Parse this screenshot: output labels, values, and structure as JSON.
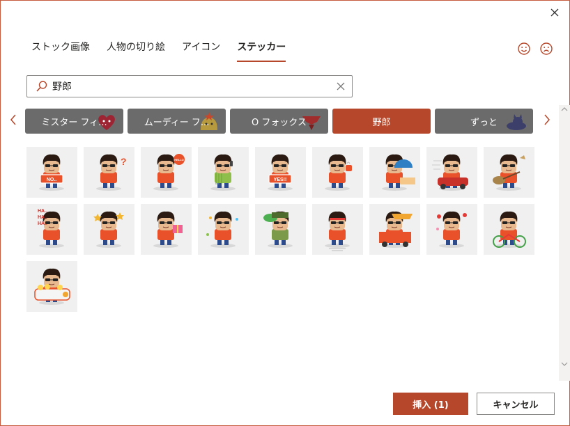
{
  "tabs": [
    {
      "label": "ストック画像",
      "active": false
    },
    {
      "label": "人物の切り絵",
      "active": false
    },
    {
      "label": "アイコン",
      "active": false
    },
    {
      "label": "ステッカー",
      "active": true
    }
  ],
  "search": {
    "value": "野郎",
    "placeholder": ""
  },
  "categories": [
    {
      "label": "ミスター フィ...",
      "active": false,
      "art": "heart"
    },
    {
      "label": "ムーディー フ...",
      "active": false,
      "art": "blob"
    },
    {
      "label": "O フォックス",
      "active": false,
      "art": "fox"
    },
    {
      "label": "野郎",
      "active": true,
      "art": ""
    },
    {
      "label": "ずっと",
      "active": false,
      "art": "cat"
    }
  ],
  "stickers": [
    {
      "name": "sticker-no-sign",
      "prop": "sign",
      "text": "NO..",
      "shirt": "#e8512a"
    },
    {
      "name": "sticker-question",
      "prop": "question",
      "text": "?",
      "shirt": "#e8512a"
    },
    {
      "name": "sticker-hello",
      "prop": "bubble",
      "text": "HELLO",
      "shirt": "#e8512a"
    },
    {
      "name": "sticker-phone",
      "prop": "phone",
      "text": "",
      "shirt": "#8fbf4a"
    },
    {
      "name": "sticker-yes",
      "prop": "sign",
      "text": "YES!!",
      "shirt": "#e8512a"
    },
    {
      "name": "sticker-coffee",
      "prop": "cup",
      "text": "",
      "shirt": "#e8512a"
    },
    {
      "name": "sticker-beach",
      "prop": "umbrella",
      "text": "",
      "shirt": "#e8512a"
    },
    {
      "name": "sticker-car",
      "prop": "car",
      "text": "",
      "shirt": "#e8512a"
    },
    {
      "name": "sticker-guitar",
      "prop": "guitar",
      "text": "",
      "shirt": "#e8512a"
    },
    {
      "name": "sticker-laugh",
      "prop": "haha",
      "text": "HA.. HA.. HA..",
      "shirt": "#e8512a"
    },
    {
      "name": "sticker-dizzy",
      "prop": "stars",
      "text": "",
      "shirt": "#e8512a"
    },
    {
      "name": "sticker-gift",
      "prop": "gift",
      "text": "",
      "shirt": "#e8512a"
    },
    {
      "name": "sticker-dance",
      "prop": "sparkle",
      "text": "",
      "shirt": "#e8512a"
    },
    {
      "name": "sticker-soldier",
      "prop": "bubble-green",
      "text": "",
      "shirt": "#7b9a4a"
    },
    {
      "name": "sticker-exercise",
      "prop": "lines",
      "text": "",
      "shirt": "#e8512a"
    },
    {
      "name": "sticker-food-cart",
      "prop": "cart",
      "text": "",
      "shirt": "#e8512a"
    },
    {
      "name": "sticker-love",
      "prop": "hearts",
      "text": "",
      "shirt": "#e8512a"
    },
    {
      "name": "sticker-bicycle",
      "prop": "bike",
      "text": "",
      "shirt": "#e8512a"
    },
    {
      "name": "sticker-bath",
      "prop": "tub",
      "text": "",
      "shirt": "#e8512a"
    }
  ],
  "buttons": {
    "insert": "挿入 (1)",
    "cancel": "キャンセル"
  },
  "icons": {
    "close": "close-icon",
    "smile": "smile-icon",
    "frown": "frown-icon",
    "search": "search-icon",
    "clear": "clear-icon",
    "prev": "chevron-left-icon",
    "next": "chevron-right-icon"
  },
  "colors": {
    "accent": "#b7472a",
    "category_bg": "#6b6b6b",
    "tile_bg": "#f0f0f0"
  }
}
